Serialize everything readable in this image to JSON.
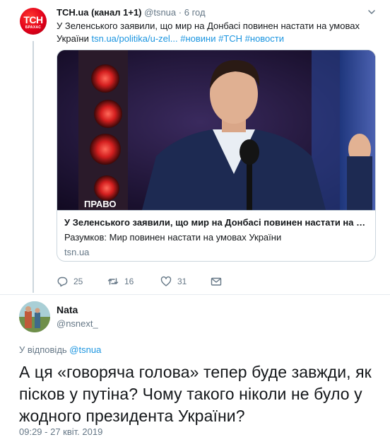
{
  "parent_tweet": {
    "avatar_icon": "tsn-logo-avatar",
    "avatar_text": "ТСН",
    "avatar_subtext": "БРАХАС",
    "display_name": "ТСН.ua (канал 1+1)",
    "handle": "@tsnua",
    "separator": "·",
    "time": "6 год",
    "text_main": "У Зеленського заявили, що мир на Донбасі повинен настати на умовах України ",
    "text_link": "tsn.ua/politika/u-zel...",
    "text_hashtags": " #новини #ТСН #новости",
    "card": {
      "image_caption": "ПРАВО",
      "title": "У Зеленського заявили, що мир на Донбасі повинен настати на у...",
      "description": "Разумков: Мир повинен настати на умовах України",
      "domain": "tsn.ua"
    },
    "actions": {
      "reply_count": "25",
      "retweet_count": "16",
      "like_count": "31"
    }
  },
  "reply_tweet": {
    "display_name": "Nata",
    "handle": "@nsnext_",
    "replying_prefix": "У відповідь ",
    "replying_to": "@tsnua",
    "text": "А ця «говоряча голова» тепер буде завжди, як пісков у путіна? Чому такого ніколи не було у жодного президента України?",
    "timestamp": "09:29 - 27 квіт. 2019"
  },
  "colors": {
    "link": "#1b95e0",
    "secondary_text": "#657786",
    "border": "#ccd6dd",
    "tsn_red": "#e2001a"
  }
}
